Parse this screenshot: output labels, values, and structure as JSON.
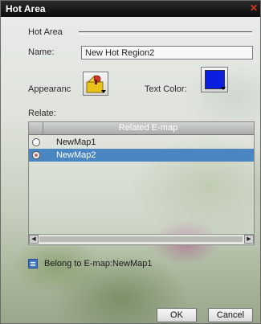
{
  "window": {
    "title": "Hot Area"
  },
  "form": {
    "section_label": "Hot Area",
    "name_label": "Name:",
    "name_value": "New Hot Region2",
    "appearance_label": "Appearanc",
    "text_color_label": "Text Color:",
    "text_color_value": "#0b1fe0",
    "relate_label": "Relate:"
  },
  "table": {
    "header": "Related E-map",
    "rows": [
      {
        "label": "NewMap1",
        "selected": false
      },
      {
        "label": "NewMap2",
        "selected": true
      }
    ]
  },
  "belong_text": "Belong to E-map:NewMap1",
  "buttons": {
    "ok": "OK",
    "cancel": "Cancel"
  },
  "icons": {
    "appearance": "region-appearance-icon",
    "close": "close-icon",
    "belong": "list-icon"
  }
}
